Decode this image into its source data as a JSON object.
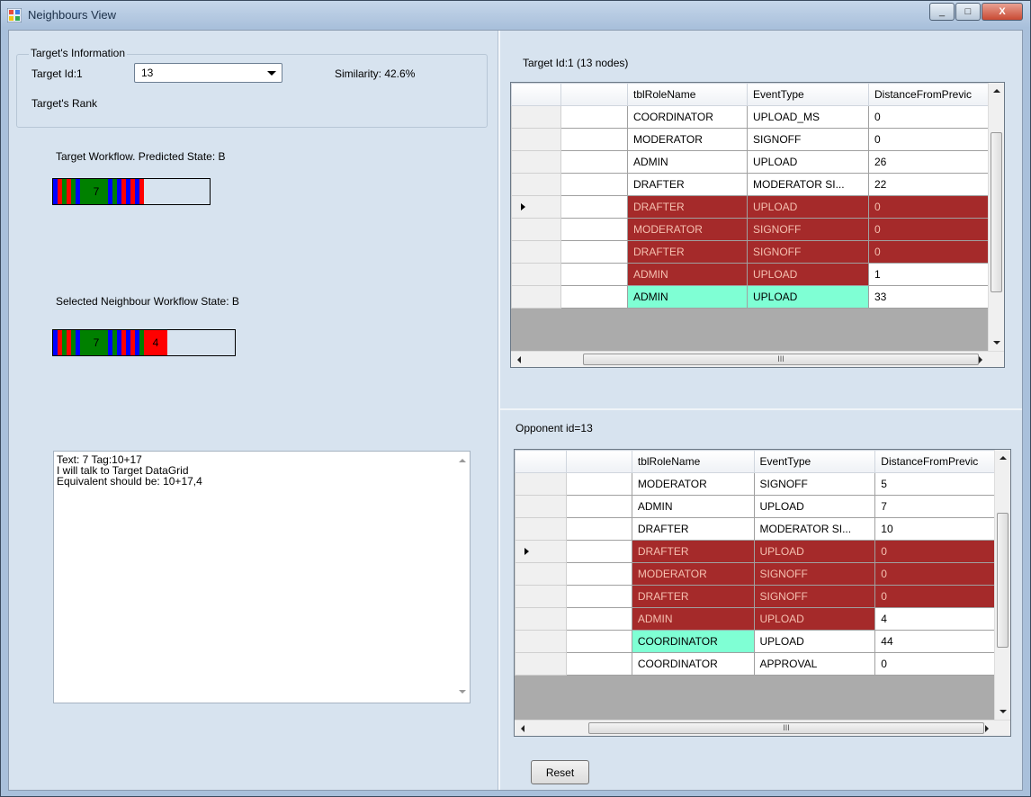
{
  "window": {
    "title": "Neighbours View"
  },
  "caption_buttons": {
    "minimize": "_",
    "maximize": "□",
    "close": "X"
  },
  "target_info": {
    "group_title": "Target's Information",
    "target_id_label": "Target Id:1",
    "combo_value": "13",
    "similarity": "Similarity: 42.6%",
    "rank_label": "Target's Rank"
  },
  "target_workflow": {
    "label": "Target Workflow. Predicted State: B",
    "segments": [
      {
        "color": "#0000ff"
      },
      {
        "color": "#ff0000"
      },
      {
        "color": "#008000"
      },
      {
        "color": "#ff0000"
      },
      {
        "color": "#008000"
      },
      {
        "color": "#0000ff"
      },
      {
        "color": "#008000"
      },
      {
        "color": "#008000",
        "text": "7"
      },
      {
        "color": "#0000ff"
      },
      {
        "color": "#008000"
      },
      {
        "color": "#0000ff"
      },
      {
        "color": "#ff0000"
      },
      {
        "color": "#0000ff"
      },
      {
        "color": "#ff0000"
      },
      {
        "color": "#0000ff"
      },
      {
        "color": "#ff0000"
      }
    ]
  },
  "neighbour_workflow": {
    "label": "Selected Neighbour Workflow State: B",
    "segments": [
      {
        "color": "#0000ff"
      },
      {
        "color": "#ff0000"
      },
      {
        "color": "#008000"
      },
      {
        "color": "#ff0000"
      },
      {
        "color": "#008000"
      },
      {
        "color": "#0000ff"
      },
      {
        "color": "#008000"
      },
      {
        "color": "#008000",
        "text": "7"
      },
      {
        "color": "#0000ff"
      },
      {
        "color": "#008000"
      },
      {
        "color": "#0000ff"
      },
      {
        "color": "#ff0000"
      },
      {
        "color": "#0000ff"
      },
      {
        "color": "#ff0000"
      },
      {
        "color": "#0000ff"
      },
      {
        "color": "#008000"
      },
      {
        "color": "#ff0000",
        "text": "4"
      }
    ]
  },
  "log_text": "Text: 7 Tag:10+17\nI will talk to Target DataGrid\nEquivalent should be: 10+17,4",
  "target_grid": {
    "caption": "Target Id:1 (13 nodes)",
    "columns": [
      "tblRoleName",
      "EventType",
      "DistanceFromPrevic"
    ],
    "rows": [
      {
        "role": "COORDINATOR",
        "event": "UPLOAD_MS",
        "dist": "0",
        "style": "white"
      },
      {
        "role": "MODERATOR",
        "event": "SIGNOFF",
        "dist": "0",
        "style": "white"
      },
      {
        "role": "ADMIN",
        "event": "UPLOAD",
        "dist": "26",
        "style": "white"
      },
      {
        "role": "DRAFTER",
        "event": "MODERATOR SI...",
        "dist": "22",
        "style": "white"
      },
      {
        "role": "DRAFTER",
        "event": "UPLOAD",
        "dist": "0",
        "style": "red",
        "current": true
      },
      {
        "role": "MODERATOR",
        "event": "SIGNOFF",
        "dist": "0",
        "style": "red"
      },
      {
        "role": "DRAFTER",
        "event": "SIGNOFF",
        "dist": "0",
        "style": "red"
      },
      {
        "role": "ADMIN",
        "event": "UPLOAD",
        "dist": "1",
        "style": "red2"
      },
      {
        "role": "ADMIN",
        "event": "UPLOAD",
        "dist": "33",
        "style": "cyan2"
      }
    ],
    "hscroll_grip": "III"
  },
  "opponent_grid": {
    "caption": "Opponent id=13",
    "columns": [
      "tblRoleName",
      "EventType",
      "DistanceFromPrevic"
    ],
    "rows": [
      {
        "role": "MODERATOR",
        "event": "SIGNOFF",
        "dist": "5",
        "style": "white"
      },
      {
        "role": "ADMIN",
        "event": "UPLOAD",
        "dist": "7",
        "style": "white"
      },
      {
        "role": "DRAFTER",
        "event": "MODERATOR SI...",
        "dist": "10",
        "style": "white"
      },
      {
        "role": "DRAFTER",
        "event": "UPLOAD",
        "dist": "0",
        "style": "red",
        "current": true
      },
      {
        "role": "MODERATOR",
        "event": "SIGNOFF",
        "dist": "0",
        "style": "red"
      },
      {
        "role": "DRAFTER",
        "event": "SIGNOFF",
        "dist": "0",
        "style": "red"
      },
      {
        "role": "ADMIN",
        "event": "UPLOAD",
        "dist": "4",
        "style": "red2"
      },
      {
        "role": "COORDINATOR",
        "event": "UPLOAD",
        "dist": "44",
        "style": "cyan1"
      },
      {
        "role": "COORDINATOR",
        "event": "APPROVAL",
        "dist": "0",
        "style": "white"
      }
    ],
    "hscroll_grip": "III"
  },
  "reset_button": "Reset"
}
